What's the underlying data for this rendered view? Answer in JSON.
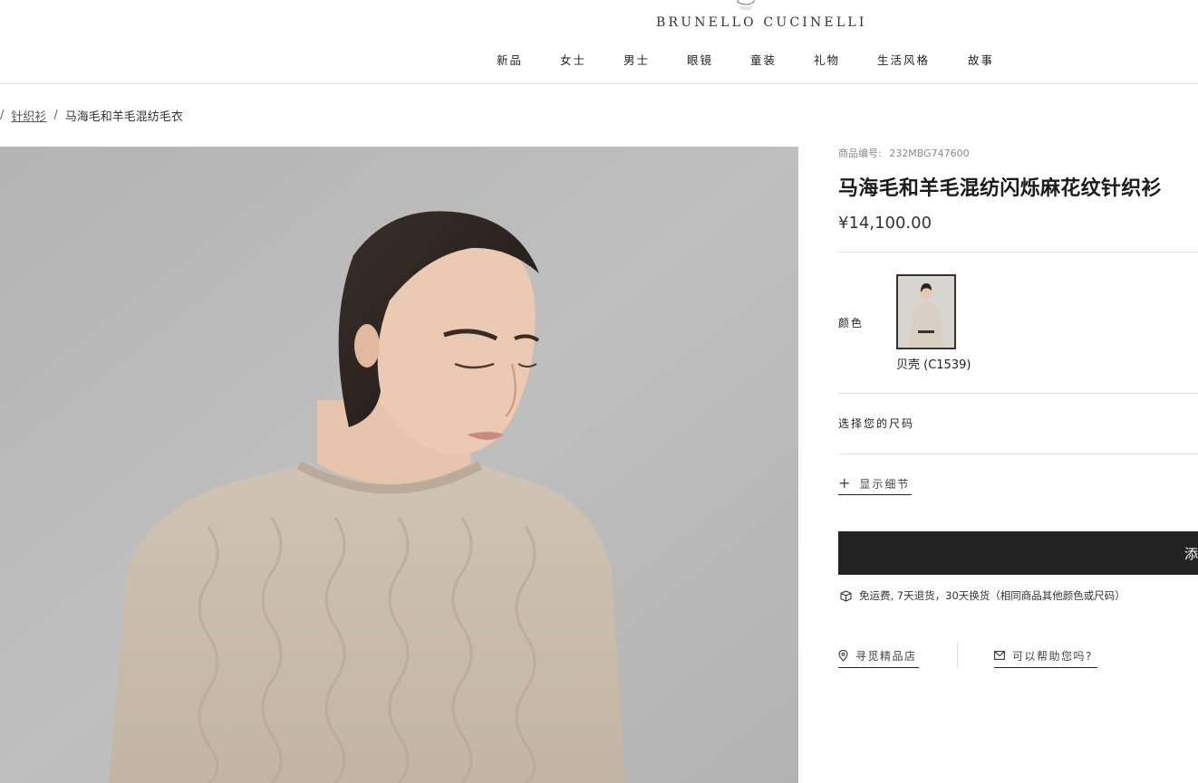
{
  "header": {
    "brand": "BRUNELLO CUCINELLI",
    "nav": [
      "新品",
      "女士",
      "男士",
      "眼镜",
      "童装",
      "礼物",
      "生活风格",
      "故事"
    ]
  },
  "breadcrumb": {
    "separator": "/",
    "category": "针织衫",
    "current": "马海毛和羊毛混纺毛衣"
  },
  "product": {
    "sku_label": "商品编号:",
    "sku": "232MBG747600",
    "title": "马海毛和羊毛混纺闪烁麻花纹针织衫",
    "price": "¥14,100.00",
    "color_label": "颜色",
    "color_name": "贝壳 (C1539)",
    "size_label": "选择您的尺码",
    "details_label": "显示细节",
    "add_to_bag": "添",
    "shipping_text": "免运费, 7天退货，30天换货（相同商品其他颜色或尺码）",
    "store_link": "寻觅精品店",
    "help_link": "可以帮助您吗?"
  },
  "icons": {
    "plus": "plus-icon",
    "shipping": "box-icon",
    "store": "location-pin-icon",
    "help": "mail-icon"
  },
  "colors": {
    "button_bg": "#222222",
    "divider": "#e2e2e2",
    "sweater": "#c9bcab",
    "wall": "#b9b9b9"
  }
}
